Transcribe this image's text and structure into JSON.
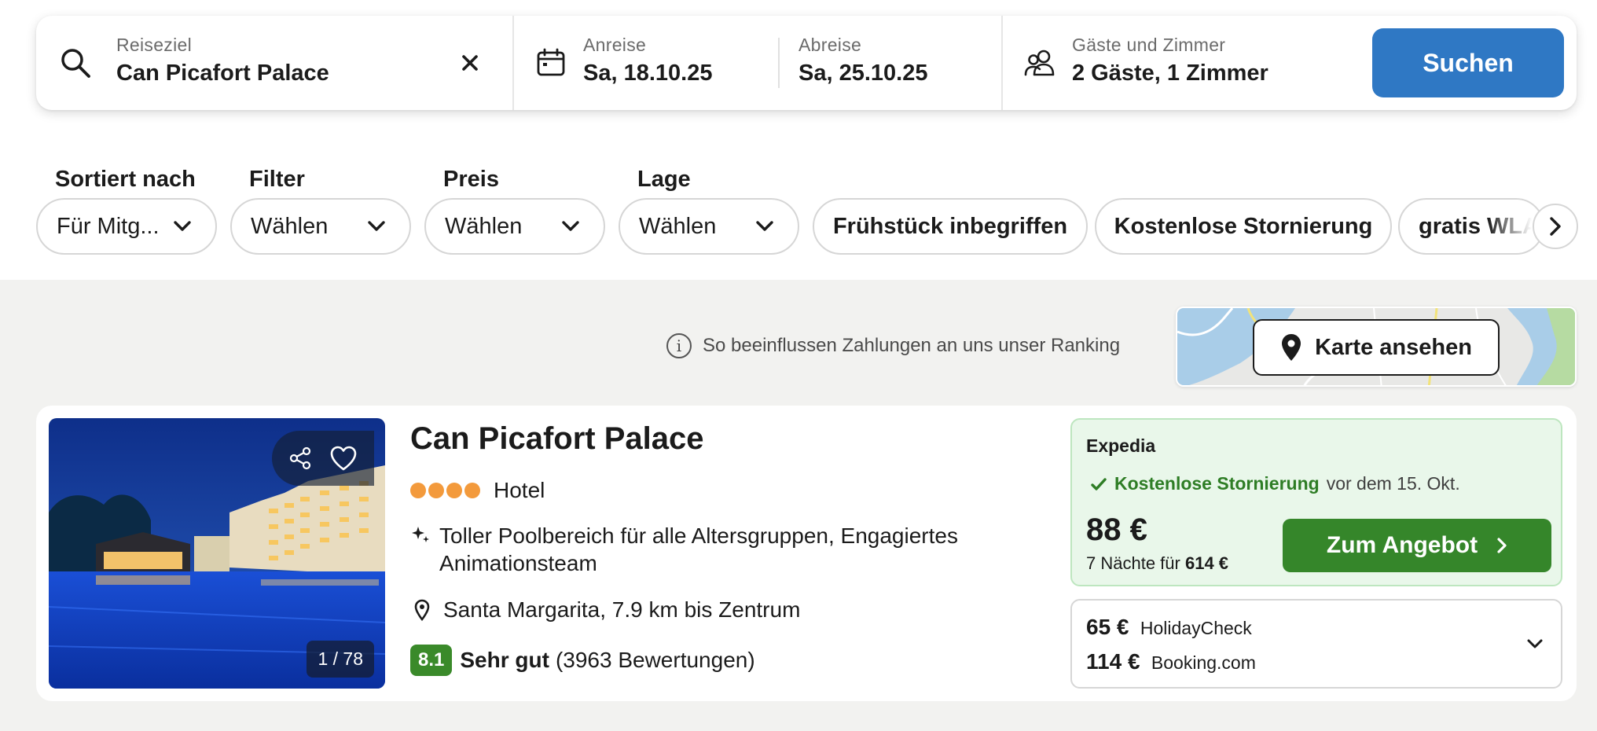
{
  "search": {
    "destination_label": "Reiseziel",
    "destination_value": "Can Picafort Palace",
    "checkin_label": "Anreise",
    "checkin_value": "Sa, 18.10.25",
    "checkout_label": "Abreise",
    "checkout_value": "Sa, 25.10.25",
    "guests_label": "Gäste und Zimmer",
    "guests_value": "2 Gäste, 1 Zimmer",
    "submit_label": "Suchen"
  },
  "filters": {
    "sort_label": "Sortiert nach",
    "sort_value": "Für Mitg...",
    "filter_label": "Filter",
    "filter_value": "Wählen",
    "price_label": "Preis",
    "price_value": "Wählen",
    "location_label": "Lage",
    "location_value": "Wählen",
    "quick_tags": [
      "Frühstück inbegriffen",
      "Kostenlose Stornierung",
      "gratis WLAN"
    ]
  },
  "ranking_note": "So beeinflussen Zahlungen an uns unser Ranking",
  "map_button": "Karte ansehen",
  "hotel": {
    "name": "Can Picafort Palace",
    "stars": 4,
    "type": "Hotel",
    "highlight": "Toller Poolbereich für alle Altersgruppen, Engagiertes Animationsteam",
    "location": "Santa Margarita, 7.9 km bis Zentrum",
    "rating_score": "8.1",
    "rating_word": "Sehr gut",
    "rating_count": "(3963 Bewertungen)",
    "photo_counter": "1 / 78",
    "offer": {
      "provider": "Expedia",
      "cancel_bold": "Kostenlose Stornierung",
      "cancel_rest": "vor dem 15. Okt.",
      "price": "88 €",
      "nights_text": "7 Nächte für",
      "nights_total": "614 €",
      "cta": "Zum Angebot"
    },
    "alternatives": [
      {
        "price": "65 €",
        "provider": "HolidayCheck"
      },
      {
        "price": "114 €",
        "provider": "Booking.com"
      }
    ]
  },
  "colors": {
    "primary_blue": "#2f78c4",
    "offer_green": "#35862a",
    "rating_green": "#3a8a2a",
    "star_orange": "#f39a3c",
    "offer_bg": "#e9f7ea"
  }
}
